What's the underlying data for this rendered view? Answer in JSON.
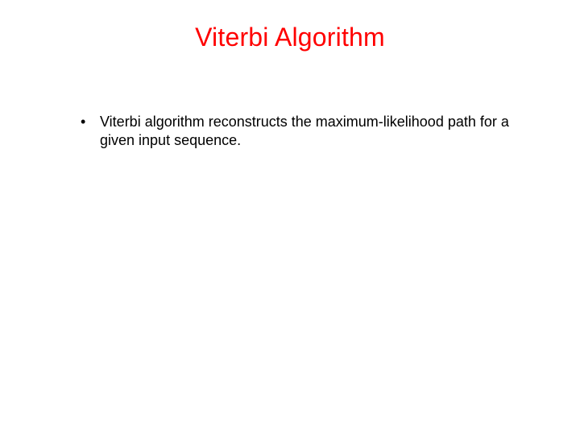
{
  "slide": {
    "title": "Viterbi Algorithm",
    "bullets": [
      "Viterbi algorithm reconstructs the maximum-likelihood path for a given input sequence."
    ]
  }
}
